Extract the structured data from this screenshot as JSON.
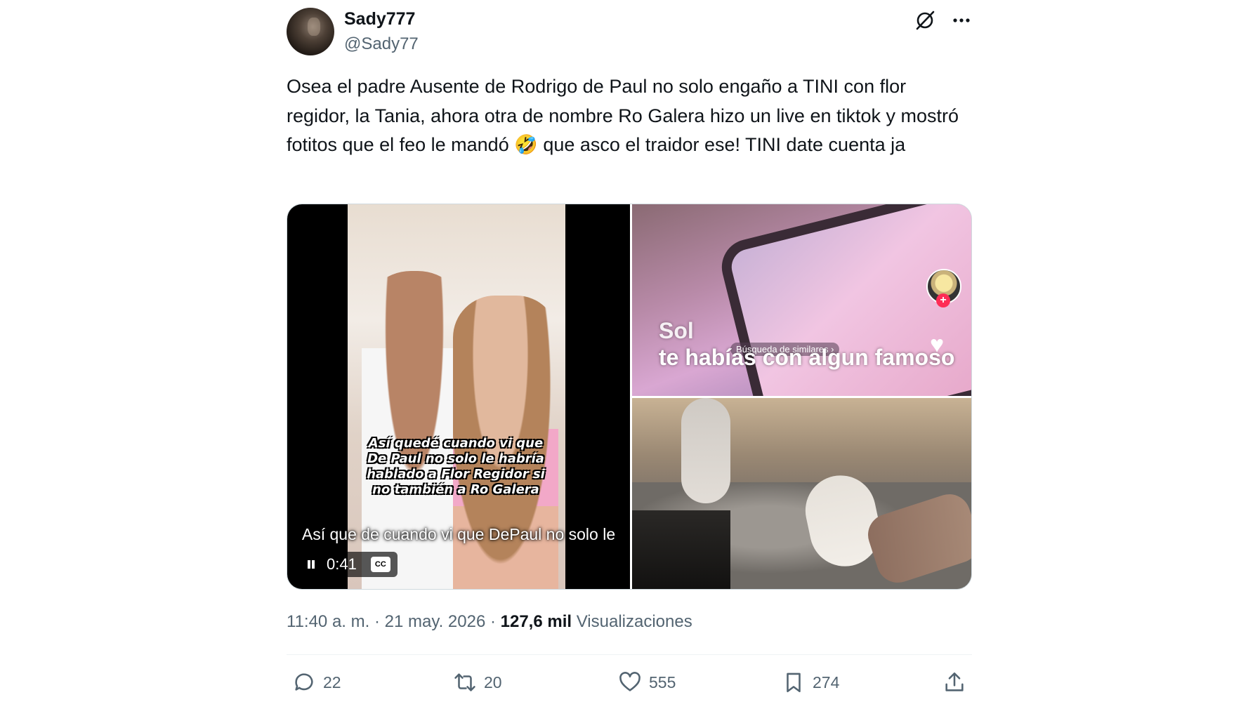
{
  "author": {
    "name": "Sady777",
    "handle": "@Sady77"
  },
  "tweet": {
    "text": "Osea el padre Ausente de Rodrigo de Paul no solo engaño a TINI con flor regidor, la Tania, ahora otra de nombre Ro Galera hizo un live en tiktok y mostró fotitos que el feo le mandó 🤣 que asco el traidor ese! TINI date cuenta ja"
  },
  "media": {
    "video": {
      "overlay_text": "Así quedé cuando vi que De Paul no solo le habría hablado a Flor Regidor si no también a Ro Galera",
      "caption": "Así que de cuando vi que DePaul no solo le",
      "time": "0:41",
      "cc_label": "CC"
    },
    "image_top": {
      "sol_text": "Sol",
      "search_chip": "Búsqueda de similares ›",
      "overlay_text": "te habías con algun famoso"
    }
  },
  "meta": {
    "time": "11:40 a. m.",
    "date": "21 may. 2026",
    "views_count": "127,6 mil",
    "views_label": "Visualizaciones"
  },
  "actions": {
    "replies": "22",
    "reposts": "20",
    "likes": "555",
    "bookmarks": "274"
  },
  "colors": {
    "text_primary": "#0f1419",
    "text_secondary": "#536471",
    "border": "#cfd9de"
  }
}
